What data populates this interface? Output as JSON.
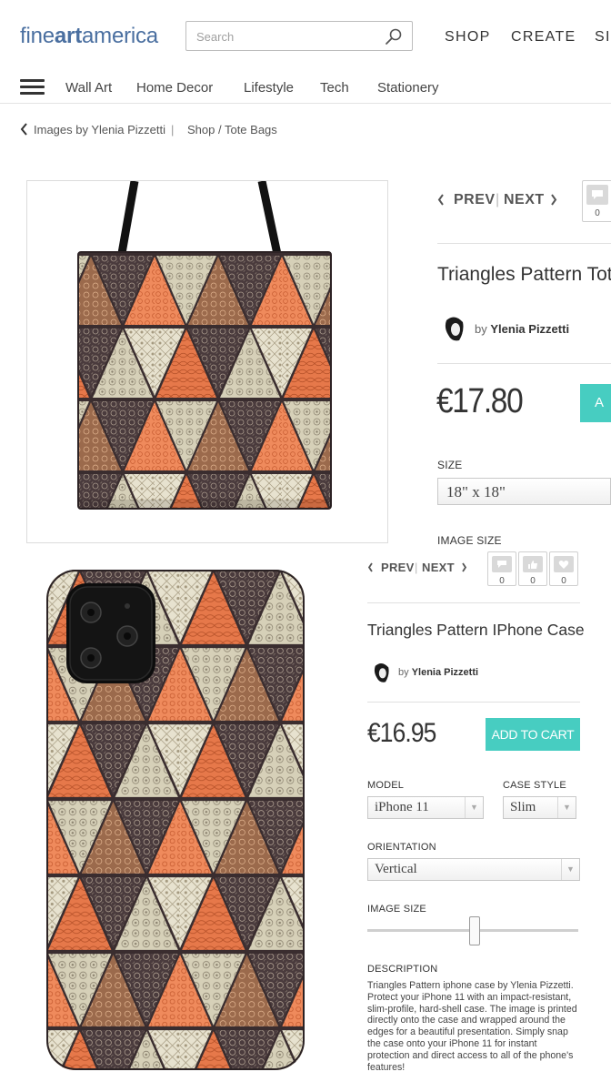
{
  "header": {
    "logo_parts": [
      "fine",
      "art",
      "america"
    ],
    "search_placeholder": "Search",
    "nav": [
      "SHOP",
      "CREATE",
      "SI"
    ]
  },
  "categories": [
    "Wall Art",
    "Home Decor",
    "Lifestyle",
    "Tech",
    "Stationery"
  ],
  "breadcrumb": {
    "back_label": "Images by Ylenia Pizzetti",
    "separator": "|",
    "path": "Shop / Tote Bags"
  },
  "tote": {
    "prev": "PREV",
    "next": "NEXT",
    "comment_count": "0",
    "title": "Triangles Pattern Tote",
    "by": "by",
    "artist": "Ylenia Pizzetti",
    "price": "€17.80",
    "cart_partial": "A",
    "size_label": "SIZE",
    "size_value": "18\" x 18\"",
    "image_size_label": "IMAGE SIZE"
  },
  "phone_case": {
    "prev": "PREV",
    "next": "NEXT",
    "counts": [
      "0",
      "0",
      "0"
    ],
    "title": "Triangles Pattern IPhone Case",
    "by": "by",
    "artist": "Ylenia Pizzetti",
    "price": "€16.95",
    "add_to_cart": "ADD TO CART",
    "model_label": "MODEL",
    "model_value": "iPhone 11",
    "case_style_label": "CASE STYLE",
    "case_style_value": "Slim",
    "orientation_label": "ORIENTATION",
    "orientation_value": "Vertical",
    "image_size_label": "IMAGE SIZE",
    "image_size_slider_level": 0.5,
    "description_label": "DESCRIPTION",
    "description": "Triangles Pattern iphone case by Ylenia Pizzetti.   Protect your iPhone 11 with an impact-resistant, slim-profile, hard-shell case. The image is printed directly onto the case and wrapped around the edges for a beautiful presentation. Simply snap the case onto your iPhone 11 for instant protection and direct access to all of the phone's features!"
  },
  "colors": {
    "logo_blue": "#4a6fa0",
    "cart_teal": "#47cdc1",
    "pattern_orange": "#e8784a",
    "pattern_cream": "#d9d3bd",
    "pattern_brown": "#4a3b3d"
  },
  "icons": [
    "search-icon",
    "menu-icon",
    "chevron-left-icon",
    "chevron-right-icon",
    "comment-icon",
    "thumbs-up-icon",
    "heart-icon",
    "chevron-down-icon"
  ]
}
